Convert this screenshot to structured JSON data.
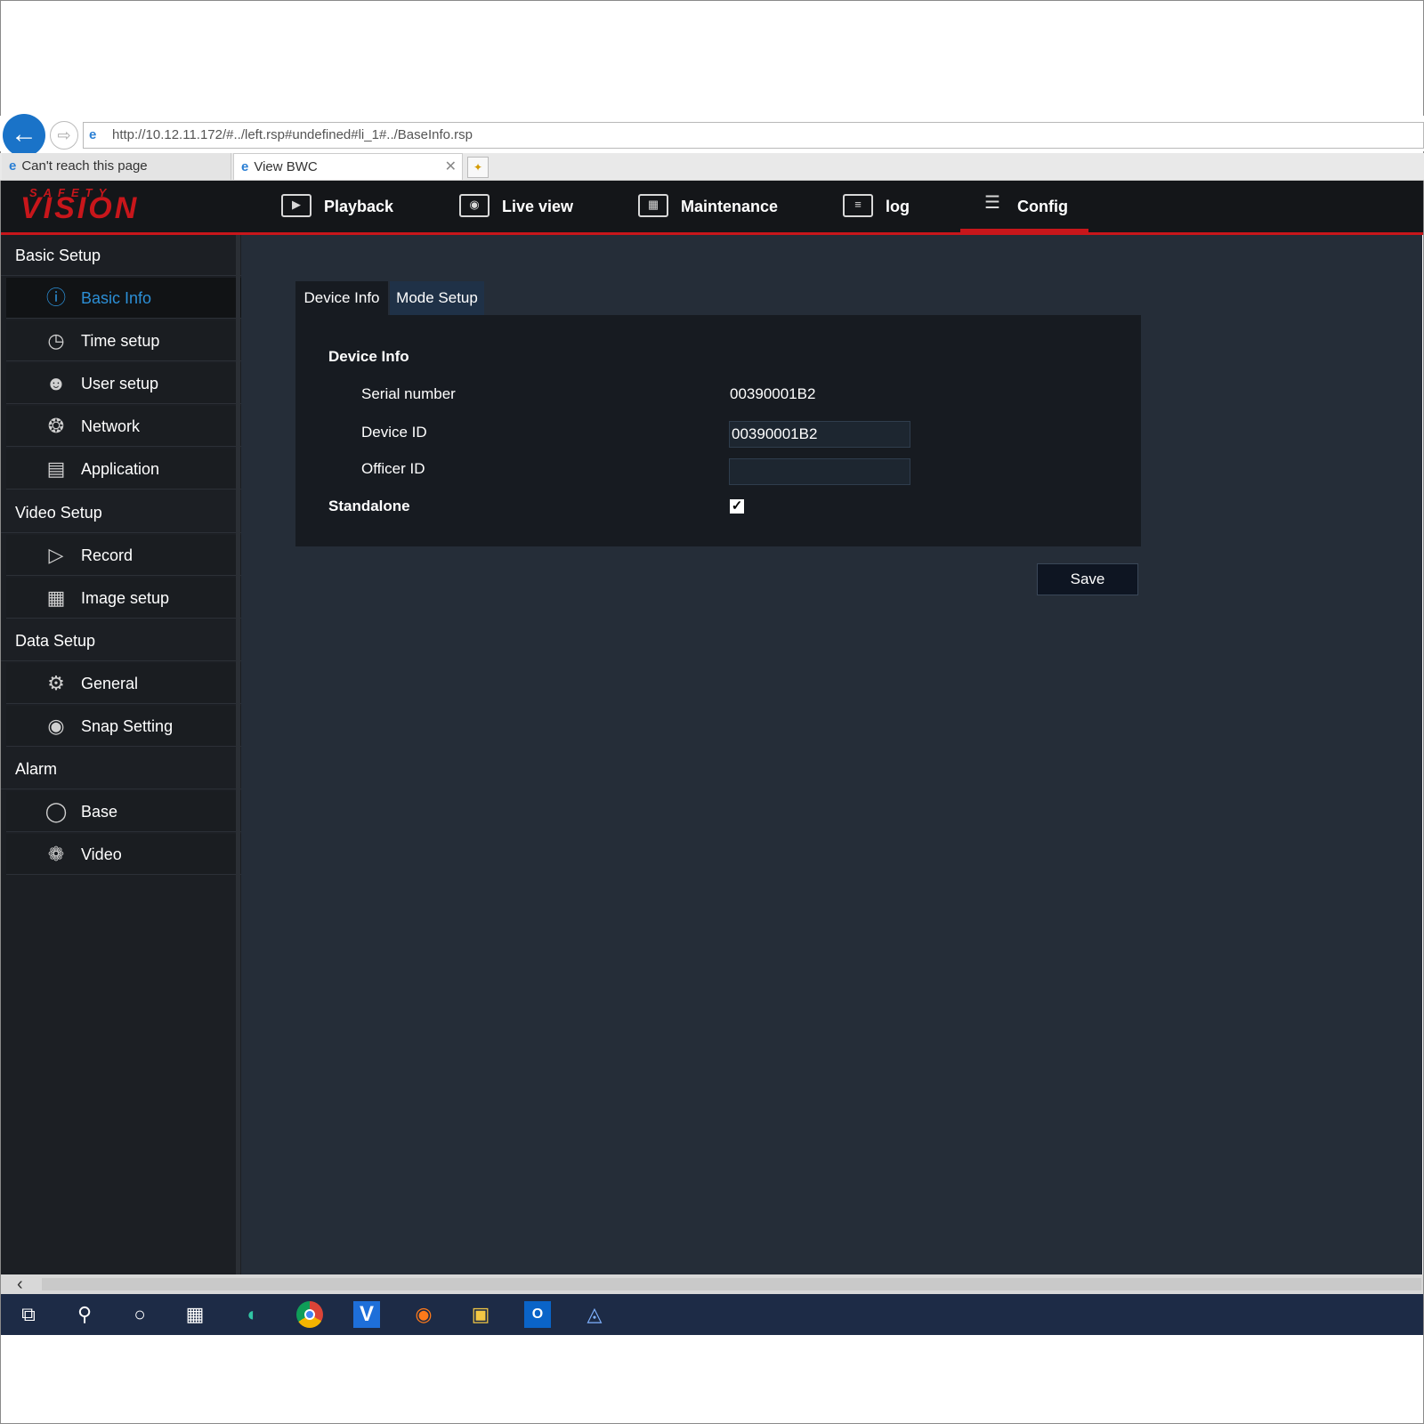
{
  "browser": {
    "url": "http://10.12.11.172/#../left.rsp#undefined#li_1#../BaseInfo.rsp",
    "tabs": [
      {
        "label": "Can't reach this page"
      },
      {
        "label": "View BWC"
      }
    ]
  },
  "app": {
    "logo_top": "SAFETY",
    "logo_main": "VISION",
    "nav": [
      {
        "label": "Playback",
        "icon": "film-icon"
      },
      {
        "label": "Live view",
        "icon": "monitor-eye-icon"
      },
      {
        "label": "Maintenance",
        "icon": "panel-icon"
      },
      {
        "label": "log",
        "icon": "list-icon"
      },
      {
        "label": "Config",
        "icon": "sliders-icon"
      }
    ],
    "accent_color": "#c8161b",
    "active_color": "#2c8fd6"
  },
  "sidebar": {
    "sections": [
      {
        "title": "Basic Setup",
        "items": [
          {
            "label": "Basic Info",
            "icon": "info-icon",
            "active": true
          },
          {
            "label": "Time setup",
            "icon": "clock-icon"
          },
          {
            "label": "User setup",
            "icon": "user-icon"
          },
          {
            "label": "Network",
            "icon": "network-globe-icon"
          },
          {
            "label": "Application",
            "icon": "application-icon"
          }
        ]
      },
      {
        "title": "Video Setup",
        "items": [
          {
            "label": "Record",
            "icon": "record-play-icon"
          },
          {
            "label": "Image setup",
            "icon": "image-settings-icon"
          }
        ]
      },
      {
        "title": "Data Setup",
        "items": [
          {
            "label": "General",
            "icon": "gear-icon"
          },
          {
            "label": "Snap Setting",
            "icon": "camera-icon"
          }
        ]
      },
      {
        "title": "Alarm",
        "items": [
          {
            "label": "Base",
            "icon": "circle-icon"
          },
          {
            "label": "Video",
            "icon": "film-reel-icon"
          }
        ]
      }
    ]
  },
  "main": {
    "tabs": [
      {
        "label": "Device Info",
        "active": true
      },
      {
        "label": "Mode Setup"
      }
    ],
    "section_title": "Device Info",
    "fields": {
      "serial_label": "Serial number",
      "serial_value": "00390001B2",
      "device_id_label": "Device ID",
      "device_id_value": "00390001B2",
      "officer_id_label": "Officer ID",
      "officer_id_value": ""
    },
    "standalone_label": "Standalone",
    "standalone_checked": true,
    "save_label": "Save"
  }
}
